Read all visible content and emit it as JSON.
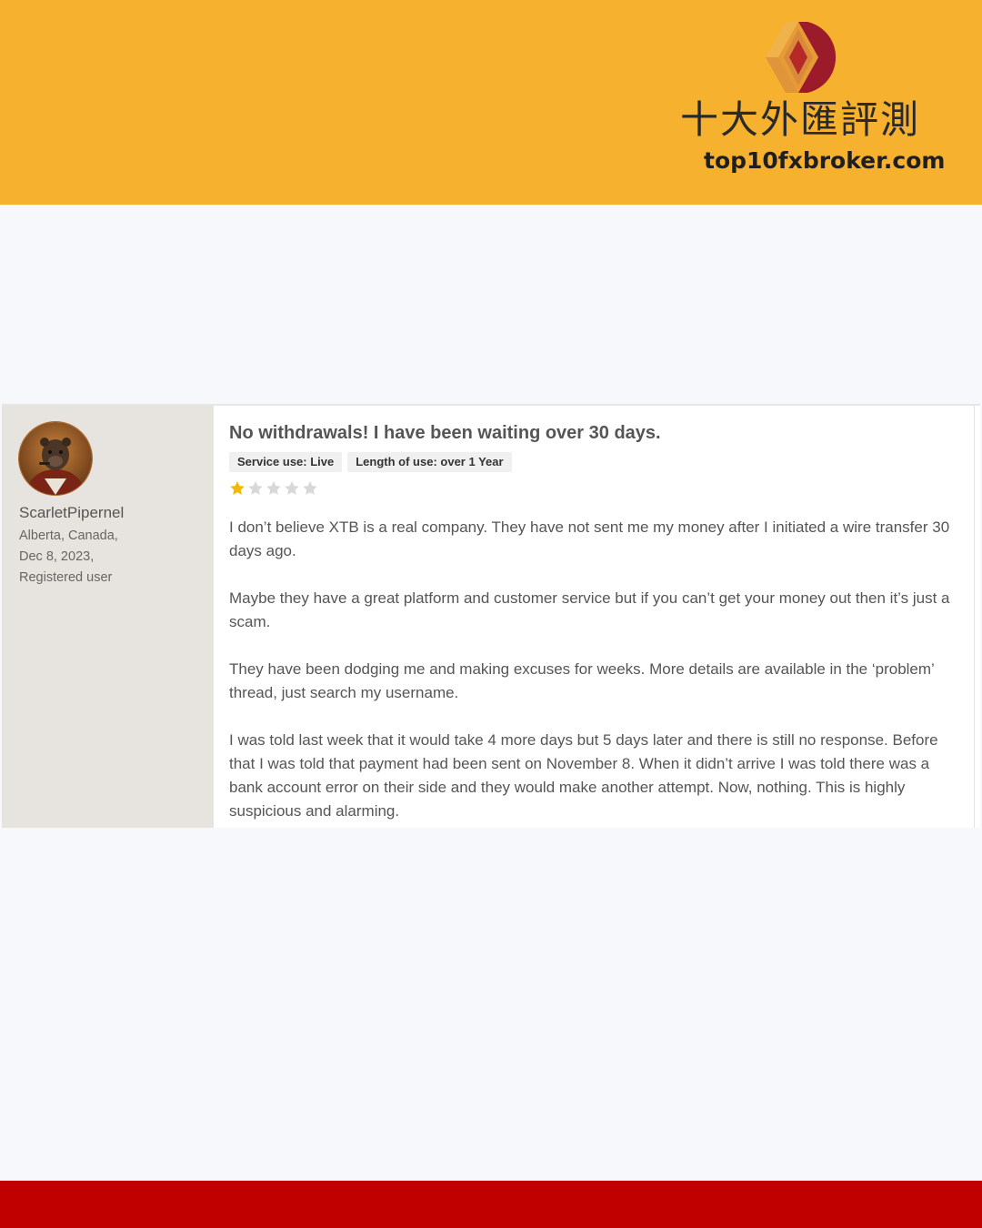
{
  "brand": {
    "chinese_name": "十大外匯評測",
    "url": "top10fxbroker.com",
    "colors": {
      "banner": "#f6b12f",
      "footer": "#c00000",
      "logo_red": "#9b1b2a",
      "logo_orange": "#e89a36"
    }
  },
  "review": {
    "user": {
      "name": "ScarletPipernel",
      "location": "Alberta, Canada,",
      "date": "Dec 8, 2023,",
      "status": "Registered user",
      "avatar_icon": "avatar-portrait"
    },
    "title": "No withdrawals! I have been waiting over 30 days.",
    "tags": {
      "service": "Service use: Live",
      "length": "Length of use: over 1 Year"
    },
    "rating": {
      "value": 1,
      "max": 5,
      "filled_color": "#f5b800",
      "empty_color": "#d8d8d8"
    },
    "paragraphs": {
      "p1": "I don’t believe XTB is a real company. They have not sent me my money after I initiated a wire transfer 30 days ago.",
      "p2": "Maybe they have a great platform and customer service but if you can’t get your money out then it’s just a scam.",
      "p3": "They have been dodging me and making excuses for weeks. More details are available in the ‘problem’ thread, just search my username.",
      "p4": "I was told last week that it would take 4 more days but 5 days later and there is still no response. Before that I was told that payment had been sent on November 8. When it didn’t arrive I was told there was a bank account error on their side and they would make another attempt. Now, nothing. This is highly suspicious and alarming."
    }
  }
}
